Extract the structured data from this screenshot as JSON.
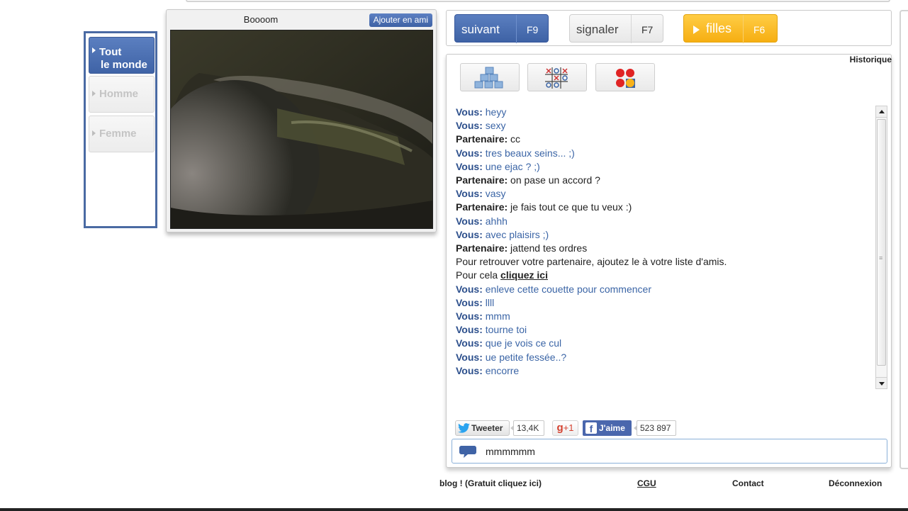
{
  "filter": {
    "items": [
      {
        "label_line1": "Tout",
        "label_line2": "le monde",
        "active": true
      },
      {
        "label": "Homme",
        "active": false
      },
      {
        "label": "Femme",
        "active": false
      }
    ]
  },
  "video": {
    "partner_name": "Boooom",
    "add_friend_label": "Ajouter en ami"
  },
  "controls": {
    "next": {
      "label": "suivant",
      "key": "F9"
    },
    "report": {
      "label": "signaler",
      "key": "F7"
    },
    "girls": {
      "label": "filles",
      "key": "F6"
    }
  },
  "chat": {
    "history_label": "Historique",
    "games": [
      "blocks-game-icon",
      "tic-tac-toe-icon",
      "connect-four-icon"
    ],
    "messages": [
      {
        "who": "Vous:",
        "text": " heyy",
        "type": "me"
      },
      {
        "who": "Vous:",
        "text": " sexy",
        "type": "me"
      },
      {
        "who": "Partenaire:",
        "text": " cc",
        "type": "partner"
      },
      {
        "who": "Vous:",
        "text": " tres beaux seins... ;)",
        "type": "me"
      },
      {
        "who": "Vous:",
        "text": " une ejac ? ;)",
        "type": "me"
      },
      {
        "who": "Partenaire:",
        "text": " on pase un accord ?",
        "type": "partner"
      },
      {
        "who": "Vous:",
        "text": " vasy",
        "type": "me"
      },
      {
        "who": "Partenaire:",
        "text": " je fais tout ce que tu veux :)",
        "type": "partner"
      },
      {
        "who": "Vous:",
        "text": " ahhh",
        "type": "me"
      },
      {
        "who": "Vous:",
        "text": " avec plaisirs ;)",
        "type": "me"
      },
      {
        "who": "Partenaire:",
        "text": " jattend tes ordres",
        "type": "partner"
      }
    ],
    "system_line1": "Pour retrouver votre partenaire, ajoutez le à votre liste d'amis.",
    "system_line2_prefix": "Pour cela ",
    "system_line2_link": "cliquez ici",
    "messages_after": [
      {
        "who": "Vous:",
        "text": " enleve cette couette pour commencer",
        "type": "me"
      },
      {
        "who": "Vous:",
        "text": " llll",
        "type": "me"
      },
      {
        "who": "Vous:",
        "text": " mmm",
        "type": "me"
      },
      {
        "who": "Vous:",
        "text": " tourne toi",
        "type": "me"
      },
      {
        "who": "Vous:",
        "text": " que je vois ce cul",
        "type": "me"
      },
      {
        "who": "Vous:",
        "text": " ue petite fessée..?",
        "type": "me"
      },
      {
        "who": "Vous:",
        "text": " encorre",
        "type": "me"
      }
    ],
    "input_value": "mmmmmm"
  },
  "social": {
    "tweet_label": "Tweeter",
    "tweet_count": "13,4K",
    "gplus_label": "+1",
    "like_label": "J'aime",
    "like_count": "523 897"
  },
  "footer": {
    "blog": "blog ! (Gratuit cliquez ici)",
    "cgu": "CGU",
    "contact": "Contact",
    "logout": "Déconnexion"
  },
  "colors": {
    "accent_blue": "#4a6aa3",
    "button_blue": "#3e62a5",
    "button_orange": "#f6ae12",
    "my_message": "#3b65a6"
  }
}
